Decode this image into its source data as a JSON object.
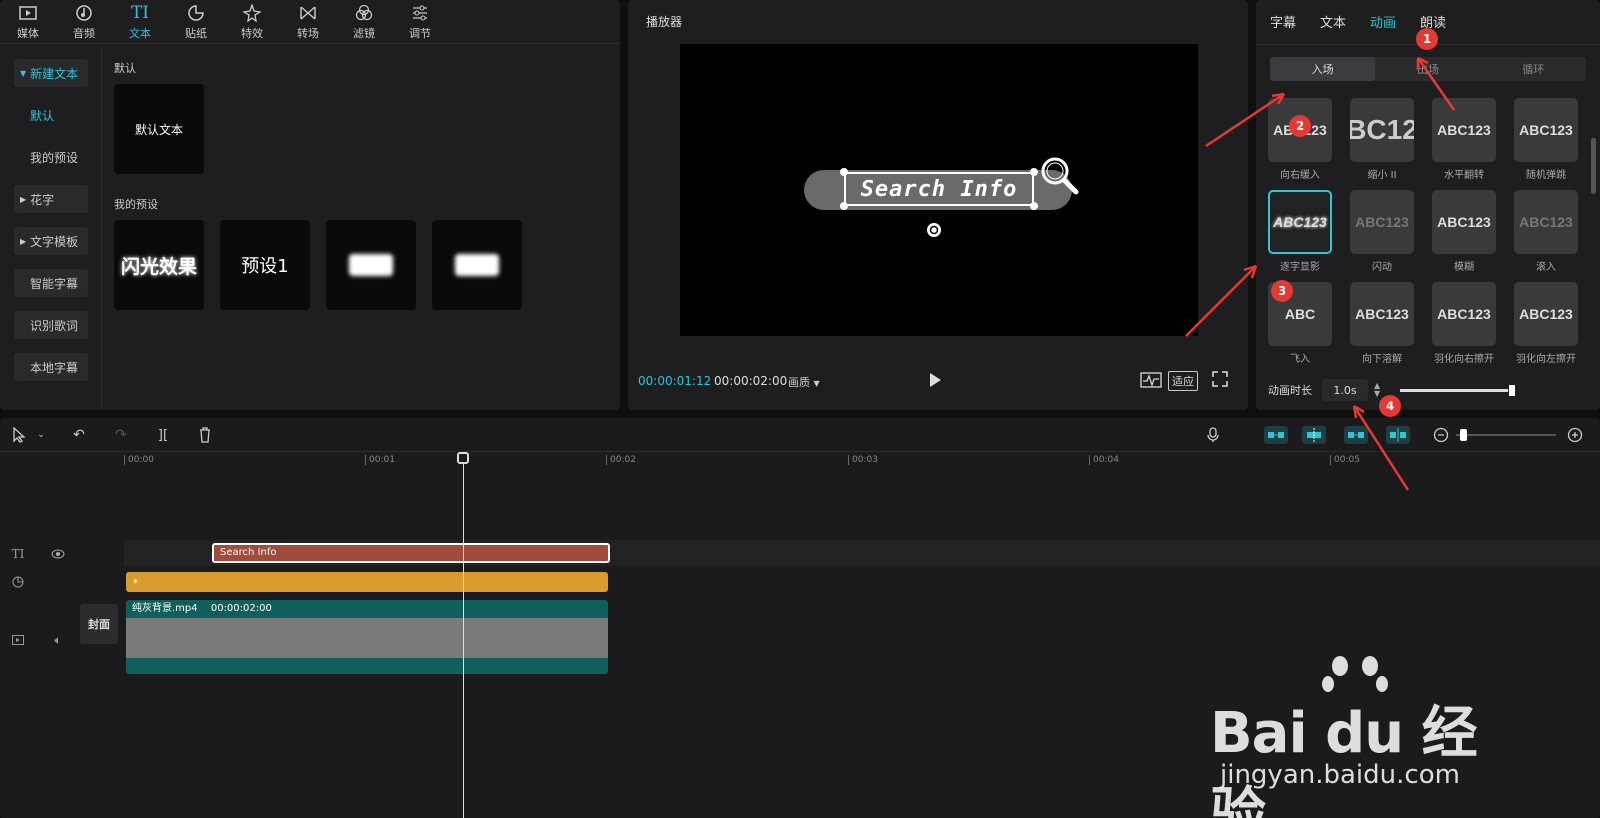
{
  "media_panel": {
    "tools": [
      {
        "label": "媒体",
        "icon": "media-icon"
      },
      {
        "label": "音频",
        "icon": "audio-icon"
      },
      {
        "label": "文本",
        "icon": "text-icon",
        "active": true
      },
      {
        "label": "贴纸",
        "icon": "sticker-icon"
      },
      {
        "label": "特效",
        "icon": "effects-icon"
      },
      {
        "label": "转场",
        "icon": "transition-icon"
      },
      {
        "label": "滤镜",
        "icon": "filter-icon"
      },
      {
        "label": "调节",
        "icon": "adjust-icon"
      }
    ],
    "nav": [
      "新建文本",
      "默认",
      "我的预设",
      "花字",
      "文字模板",
      "智能字幕",
      "识别歌词",
      "本地字幕"
    ],
    "default_section": "默认",
    "default_tile": "默认文本",
    "preset_section": "我的预设",
    "presets": [
      "闪光效果",
      "预设1"
    ]
  },
  "player": {
    "title": "播放器",
    "overlay_text": "Search Info",
    "current_time": "00:00:01:12",
    "total_time": "00:00:02:00",
    "quality_label": "画质",
    "fit_label": "适应"
  },
  "inspector": {
    "tabs": [
      "字幕",
      "文本",
      "动画",
      "朗读"
    ],
    "active_tab": "动画",
    "segments": [
      "入场",
      "出场",
      "循环"
    ],
    "animations": [
      {
        "thumb": "ABC123",
        "name": "向右缓入"
      },
      {
        "thumb": "BC12",
        "name": "缩小 II"
      },
      {
        "thumb": "ABC123",
        "name": "水平翻转"
      },
      {
        "thumb": "ABC123",
        "name": "随机弹跳"
      },
      {
        "thumb": "ABC123",
        "name": "逐字显影",
        "selected": true
      },
      {
        "thumb": "ABC123",
        "name": "闪动"
      },
      {
        "thumb": "ABC123",
        "name": "模糊"
      },
      {
        "thumb": "ABC123",
        "name": "滚入"
      },
      {
        "thumb": "ABC",
        "name": "飞入"
      },
      {
        "thumb": "ABC123",
        "name": "向下溶解"
      },
      {
        "thumb": "ABC123",
        "name": "羽化向右擦开"
      },
      {
        "thumb": "ABC123",
        "name": "羽化向左擦开"
      }
    ],
    "duration_label": "动画时长",
    "duration_value": "1.0s"
  },
  "annotations": [
    "1",
    "2",
    "3",
    "4"
  ],
  "timeline": {
    "ruler": [
      "00:00",
      "00:01",
      "00:02",
      "00:03",
      "00:04",
      "00:05"
    ],
    "text_clip": "Search Info",
    "audio_clip": "",
    "video_clip_name": "纯灰背景.mp4",
    "video_clip_duration": "00:00:02:00",
    "cover_label": "封面"
  },
  "watermark": {
    "main": "Bai du 经验",
    "sub": "jingyan.baidu.com"
  },
  "colors": {
    "accent": "#2fc4d6",
    "text_clip": "#a14b3c",
    "audio_clip": "#d99a2e",
    "video_clip": "#0f5f5c",
    "annotation": "#e53935"
  }
}
